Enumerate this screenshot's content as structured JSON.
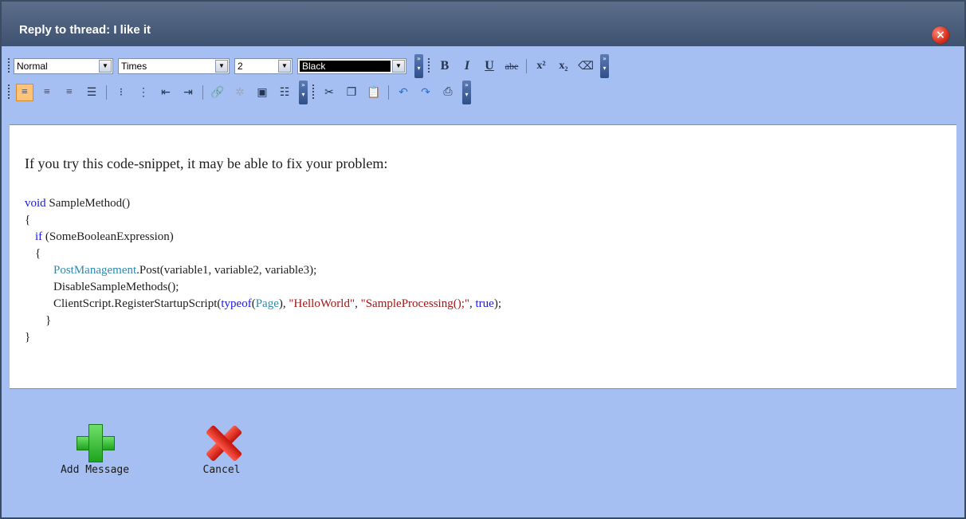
{
  "window": {
    "title": "Reply to thread: I like it",
    "close_symbol": "×"
  },
  "toolbar": {
    "paragraph_format": "Normal",
    "font_name": "Times",
    "font_size": "2",
    "font_color": "Black",
    "format_buttons": {
      "bold": "B",
      "italic": "I",
      "underline": "U",
      "strikethrough": "abe",
      "superscript": "x²",
      "subscript": "x₂"
    }
  },
  "editor": {
    "intro": "If you try this code-snippet, it may be able to fix your problem:",
    "code": {
      "l1_kw": "void",
      "l1_rest": " SampleMethod()",
      "l2": "{",
      "l3_kw": "if",
      "l3_rest": " (SomeBooleanExpression)",
      "l4": "{",
      "l5_type": "PostManagement",
      "l5_rest": ".Post(variable1, variable2, variable3);",
      "l6": "DisableSampleMethods();",
      "l7_a": "ClientScript.RegisterStartupScript(",
      "l7_kw": "typeof",
      "l7_b": "(",
      "l7_type": "Page",
      "l7_c": "), ",
      "l7_str1": "\"HelloWorld\"",
      "l7_d": ", ",
      "l7_str2": "\"SampleProcessing();\"",
      "l7_e": ", ",
      "l7_kw2": "true",
      "l7_f": ");",
      "l8": "}",
      "l9": "}"
    }
  },
  "actions": {
    "add_label": "Add Message",
    "cancel_label": "Cancel"
  },
  "colors": {
    "keyword": "#1a1adb",
    "type": "#2b8ab0",
    "string": "#a31515",
    "panel": "#a5bff2",
    "titlebar": "#3e5271"
  }
}
